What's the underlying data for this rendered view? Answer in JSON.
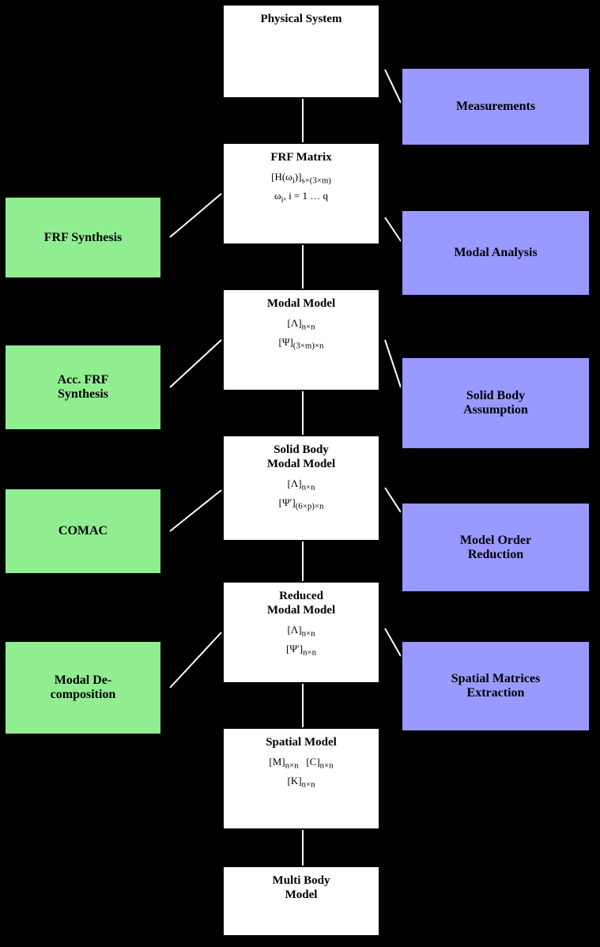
{
  "boxes": {
    "physical_system": {
      "title": "Physical System",
      "content": ""
    },
    "measurements": {
      "title": "Measurements"
    },
    "frf_matrix": {
      "title": "FRF Matrix",
      "line1": "[H(ω",
      "line1b": "i",
      "line1c": ")]",
      "line1d": "s×(3×m)",
      "line2": "ω",
      "line2b": "i",
      "line2c": ", i = 1 … q"
    },
    "modal_analysis": {
      "title": "Modal Analysis"
    },
    "frf_synthesis": {
      "title": "FRF Synthesis"
    },
    "modal_model": {
      "title": "Modal Model"
    },
    "solid_body_assumption": {
      "title": "Solid Body Assumption"
    },
    "acc_frf_synthesis": {
      "title": "Acc. FRF Synthesis"
    },
    "solid_body_modal_model": {
      "title": "Solid Body Modal Model"
    },
    "model_order_reduction": {
      "title": "Model Order Reduction"
    },
    "comac": {
      "title": "COMAC"
    },
    "reduced_modal_model": {
      "title": "Reduced Modal Model"
    },
    "spatial_matrices_extraction": {
      "title": "Spatial Matrices Extraction"
    },
    "modal_decomposition": {
      "title": "Modal Decomposition"
    },
    "spatial_model": {
      "title": "Spatial Model"
    },
    "multi_body_model": {
      "title": "Multi Body Model"
    }
  }
}
